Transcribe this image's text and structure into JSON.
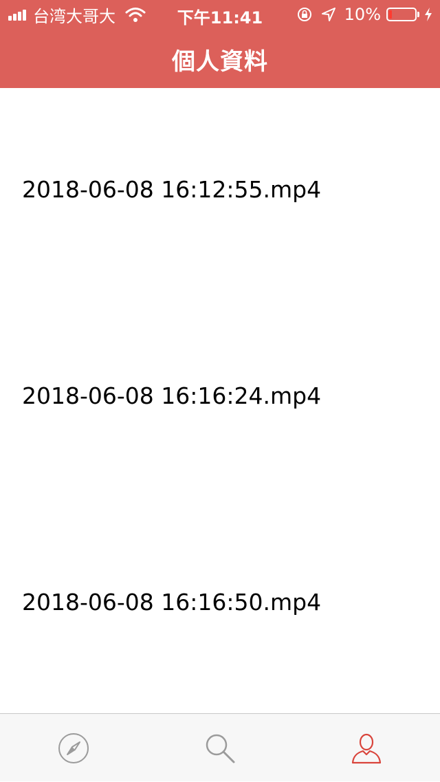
{
  "status_bar": {
    "carrier": "台湾大哥大",
    "time": "下午11:41",
    "battery_percent": "10%",
    "battery_level": 0.1,
    "icons": [
      "signal-icon",
      "wifi-icon",
      "orientation-lock-icon",
      "location-icon",
      "battery-icon",
      "charging-icon"
    ]
  },
  "header": {
    "title": "個人資料"
  },
  "files": [
    {
      "name": "2018-06-08 16:12:55.mp4"
    },
    {
      "name": "2018-06-08 16:16:24.mp4"
    },
    {
      "name": "2018-06-08 16:16:50.mp4"
    }
  ],
  "tab_bar": {
    "tabs": [
      {
        "icon": "compass-icon",
        "active": false
      },
      {
        "icon": "search-icon",
        "active": false
      },
      {
        "icon": "profile-icon",
        "active": true
      }
    ]
  },
  "colors": {
    "accent": "#DC605A",
    "tab_inactive": "#9B9B9B",
    "tab_active": "#D9443B",
    "tab_bar_bg": "#F7F7F7"
  }
}
